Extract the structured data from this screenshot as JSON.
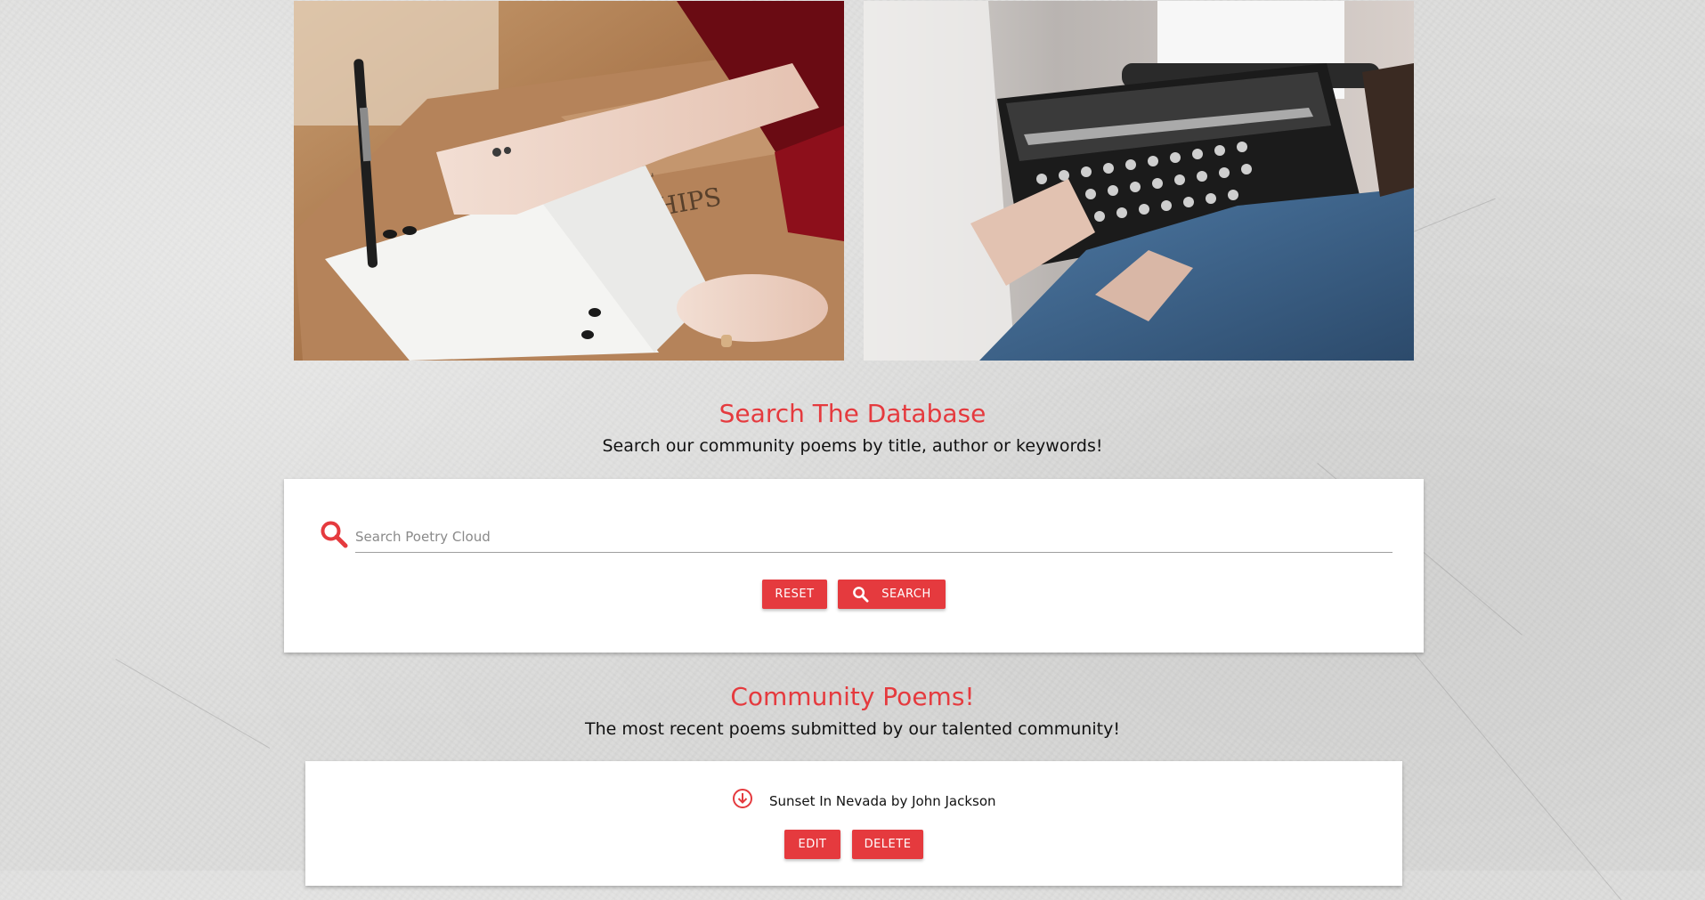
{
  "search_section": {
    "title": "Search The Database",
    "subtitle": "Search our community poems by title, author or keywords!",
    "input_placeholder": "Search Poetry Cloud",
    "input_value": "",
    "reset_label": "RESET",
    "search_label": "SEARCH"
  },
  "poems_section": {
    "title": "Community Poems!",
    "subtitle": "The most recent poems submitted by our talented community!",
    "poems": [
      {
        "title": "Sunset In Nevada by John Jackson",
        "edit_label": "EDIT",
        "delete_label": "DELETE"
      }
    ]
  },
  "icons": {
    "search": "search-icon",
    "expand": "arrow-down-circle-icon"
  },
  "colors": {
    "accent": "#e53a3e",
    "background": "#dcdcdb",
    "card": "#ffffff"
  }
}
